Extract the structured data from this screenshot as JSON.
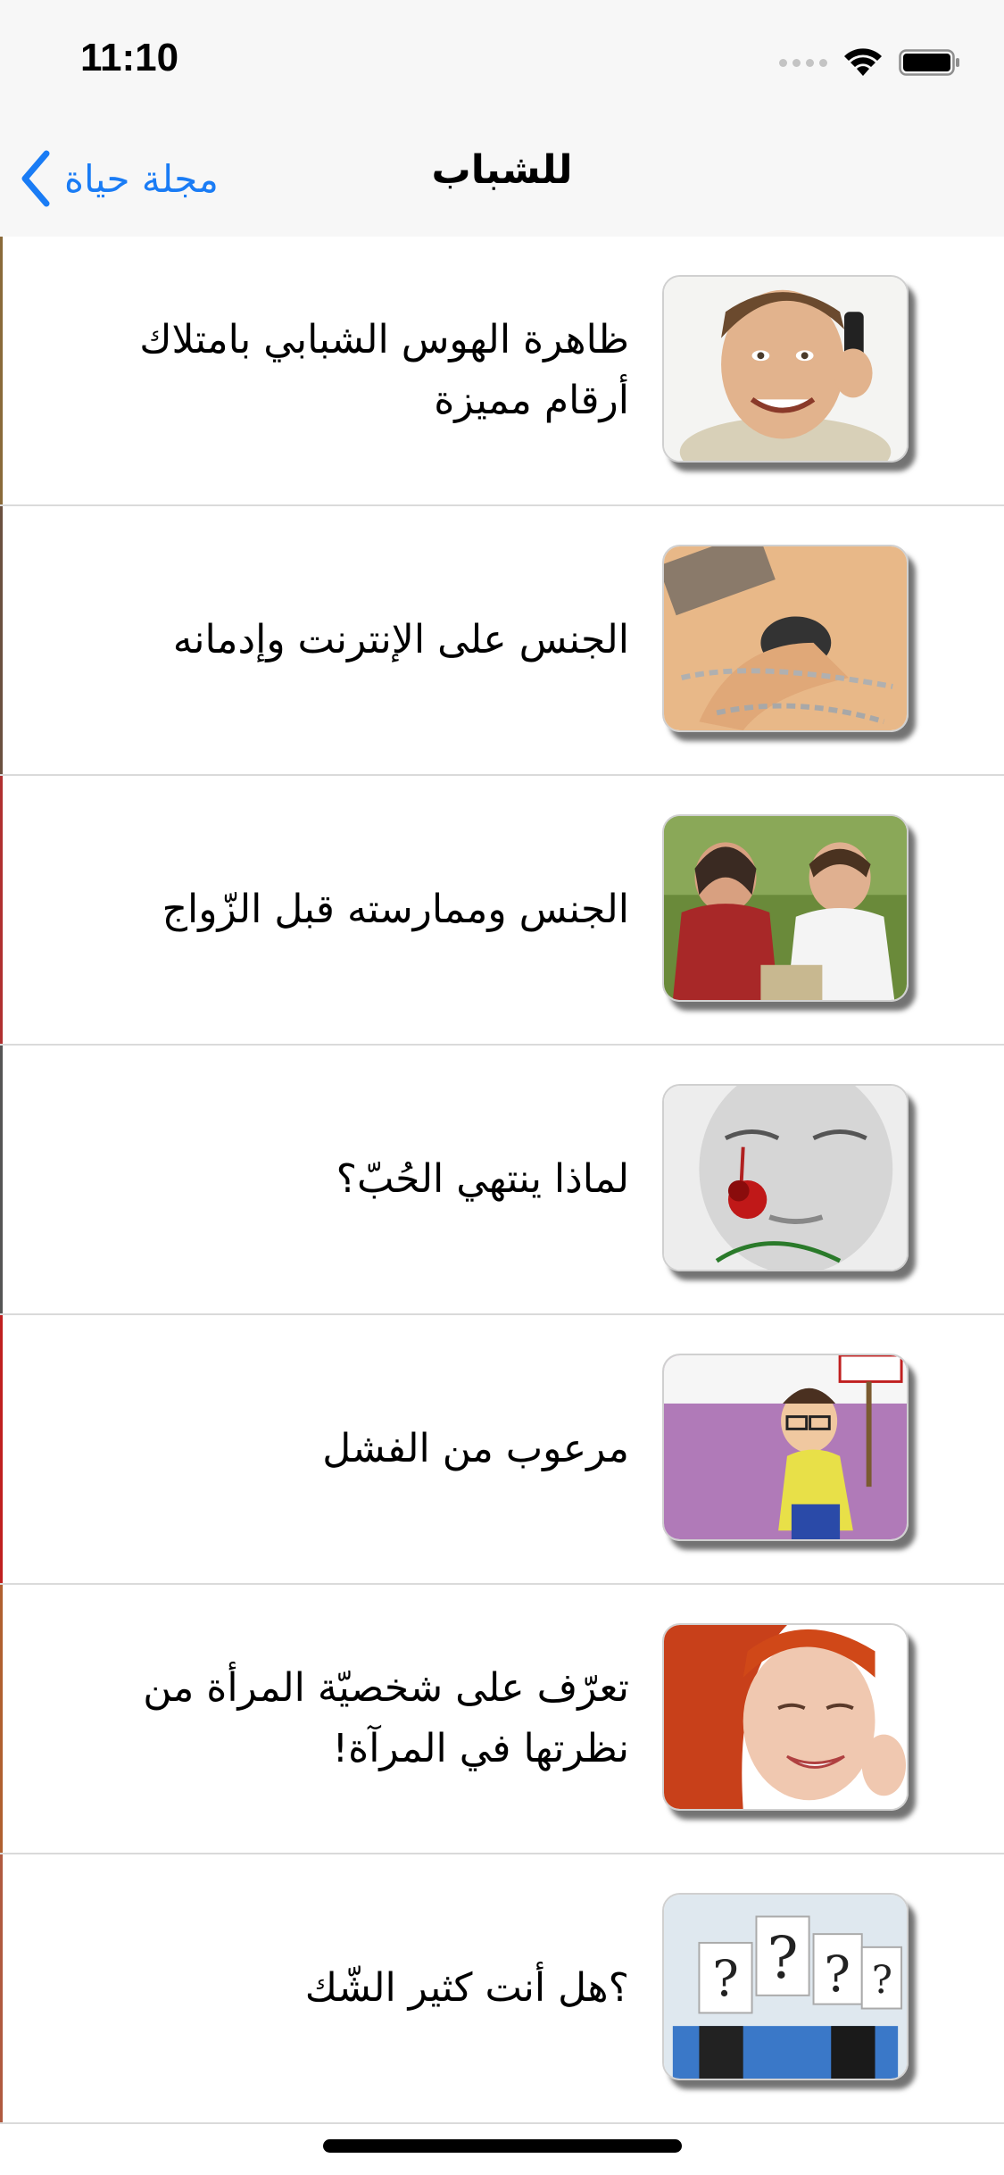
{
  "status_bar": {
    "time": "11:10",
    "icons": [
      "signal-icon",
      "wifi-icon",
      "battery-icon"
    ]
  },
  "nav": {
    "back_label": "مجلة حياة",
    "title": "للشباب",
    "accent_color": "#1a7cf5"
  },
  "articles": [
    {
      "title": "ظاهرة الهوس الشبابي بامتلاك أرقام مميزة",
      "image": "man-on-phone"
    },
    {
      "title": "الجنس على الإنترنت وإدمانه",
      "image": "hand-on-mouse-chained"
    },
    {
      "title": "الجنس وممارسته قبل الزّواج",
      "image": "sad-couple"
    },
    {
      "title": "لماذا ينتهي الحُبّ؟",
      "image": "crying-woman-rose"
    },
    {
      "title": "مرعوب من الفشل",
      "image": "scared-cartoon-man"
    },
    {
      "title": "تعرّف على شخصيّة المرأة من نظرتها في المرآة!",
      "image": "smiling-woman"
    },
    {
      "title": "؟هل أنت كثير الشّك",
      "image": "question-mark-signs"
    }
  ]
}
